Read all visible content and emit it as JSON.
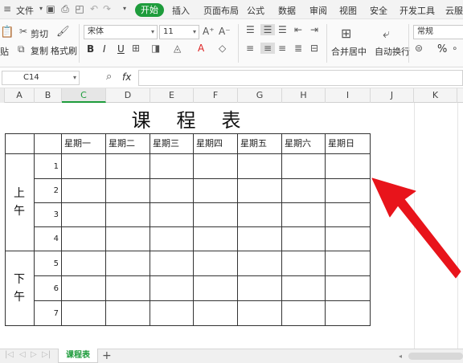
{
  "menu": {
    "file_label": "文件",
    "tabs": [
      "开始",
      "插入",
      "页面布局",
      "公式",
      "数据",
      "审阅",
      "视图",
      "安全",
      "开发工具",
      "云服务"
    ]
  },
  "ribbon": {
    "cut_label": "剪切",
    "paste_label": "贴",
    "copy_label": "复制",
    "format_painter_label": "格式刷",
    "font_name": "宋体",
    "font_size": "11",
    "bold": "B",
    "italic": "I",
    "underline": "U",
    "merge_label": "合并居中",
    "wrap_label": "自动换行",
    "number_format": "常规",
    "percent_symbol": "%"
  },
  "formula_bar": {
    "name_box": "C14",
    "fx_label": "fx",
    "formula": ""
  },
  "columns": [
    "A",
    "B",
    "C",
    "D",
    "E",
    "F",
    "G",
    "H",
    "I",
    "J",
    "K"
  ],
  "active_column": "C",
  "timetable": {
    "title": "课　程　表",
    "days": [
      "星期一",
      "星期二",
      "星期三",
      "星期四",
      "星期五",
      "星期六",
      "星期日"
    ],
    "morning_label": "上\n午",
    "afternoon_label": "下\n午",
    "periods": [
      "1",
      "2",
      "3",
      "4",
      "5",
      "6",
      "7"
    ]
  },
  "sheet_tabs": [
    {
      "label": "课程表",
      "active": true
    }
  ],
  "add_sheet_label": "+",
  "colors": {
    "accent": "#1e9c3c",
    "arrow": "#e8141b"
  }
}
